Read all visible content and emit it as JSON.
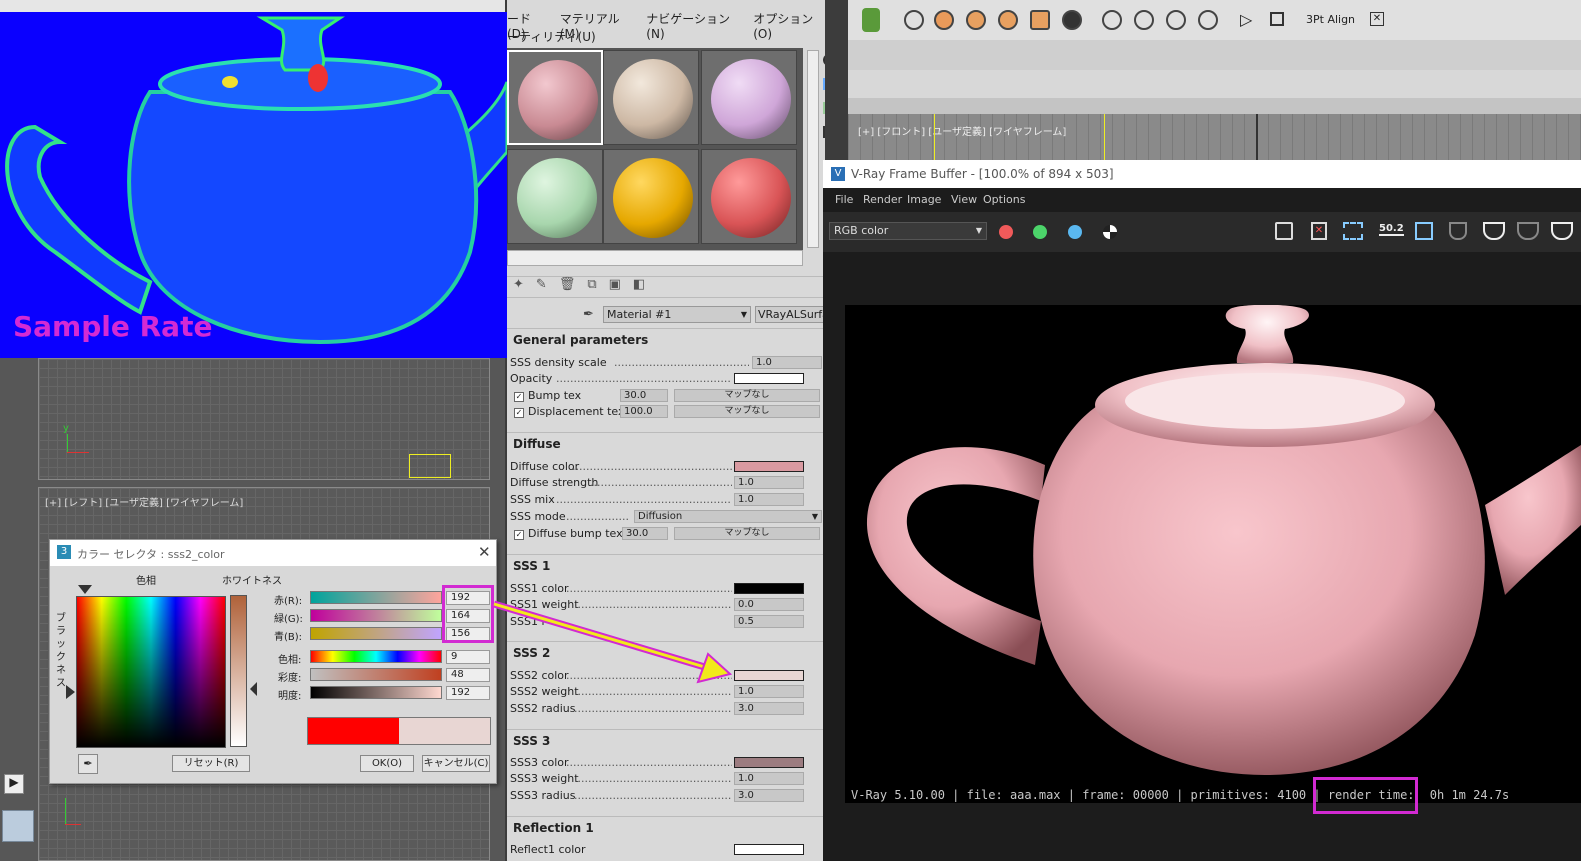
{
  "sample_panel": {
    "label": "Sample Rate"
  },
  "mated": {
    "menu1": [
      "ード(D)",
      "マテリアル(M)",
      "ナビゲーション(N)",
      "オプション(O)"
    ],
    "menu2": "ーティリティ(U)",
    "material_name": "Material #1",
    "material_type": "VRayALSurfac",
    "swatch_colors": [
      "#c98a93",
      "#cdb8a4",
      "#cfa6d8",
      "#a8d6ad",
      "#e6a800",
      "#d95456"
    ],
    "general": {
      "title": "General parameters",
      "sss_density_label": "SSS density scale",
      "sss_density_value": "1.0",
      "opacity_label": "Opacity",
      "bump_label": "Bump tex",
      "bump_value": "30.0",
      "bump_map": "マップなし",
      "disp_label": "Displacement tex",
      "disp_value": "100.0",
      "disp_map": "マップなし"
    },
    "diffuse": {
      "title": "Diffuse",
      "color_label": "Diffuse color",
      "strength_label": "Diffuse strength",
      "strength_value": "1.0",
      "mix_label": "SSS mix",
      "mix_value": "1.0",
      "mode_label": "SSS mode",
      "mode_value": "Diffusion",
      "bump_label": "Diffuse bump tex",
      "bump_value": "30.0",
      "bump_map": "マップなし"
    },
    "sss1": {
      "title": "SSS 1",
      "color_label": "SSS1 color",
      "weight_label": "SSS1 weight",
      "weight_value": "0.0",
      "radius_label": "SSS1 r",
      "radius_value": "0.5"
    },
    "sss2": {
      "title": "SSS 2",
      "color_label": "SSS2 color",
      "weight_label": "SSS2 weight",
      "weight_value": "1.0",
      "radius_label": "SSS2 radius",
      "radius_value": "3.0"
    },
    "sss3": {
      "title": "SSS 3",
      "color_label": "SSS3 color",
      "weight_label": "SSS3 weight",
      "weight_value": "1.0",
      "radius_label": "SSS3 radius",
      "radius_value": "3.0"
    },
    "reflection": {
      "title": "Reflection 1",
      "color_label": "Reflect1 color"
    }
  },
  "viewports": {
    "left_label": "[+] [レフト] [ユーザ定義] [ワイヤフレーム]",
    "front_label": "[+] [フロント] [ユーザ定義] [ワイヤフレーム]"
  },
  "color_selector": {
    "title": "カラー セレクタ : sss2_color",
    "hue_label": "色相",
    "white_label": "ホワイトネス",
    "black_label": "ブラックネス",
    "red_label": "赤(R):",
    "green_label": "緑(G):",
    "blue_label": "青(B):",
    "hue2_label": "色相:",
    "sat_label": "彩度:",
    "bright_label": "明度:",
    "red": "192",
    "green": "164",
    "blue": "156",
    "hue": "9",
    "sat": "48",
    "bright": "192",
    "reset": "リセット(R)",
    "ok": "OK(O)",
    "cancel": "キャンセル(C)"
  },
  "toolbar": {
    "align_label": "3Pt Align"
  },
  "vfb": {
    "title": "V-Ray Frame Buffer - [100.0% of 894 x 503]",
    "menu": [
      "File",
      "Render",
      "Image",
      "View",
      "Options"
    ],
    "channel": "RGB color",
    "zoom_badge": "50.2",
    "status": "V-Ray 5.10.00 | file: aaa.max | frame: 00000 | primitives: 4100 | render time:",
    "render_time": "0h  1m 24.7s"
  },
  "colors": {
    "highlight": "#d22ad2",
    "arrow": "#f2ea1a",
    "diffuse": "#d99aa1",
    "sss2": "#e8d6d3",
    "sss3": "#9c7c80",
    "teapot": "#e7a7b0"
  }
}
